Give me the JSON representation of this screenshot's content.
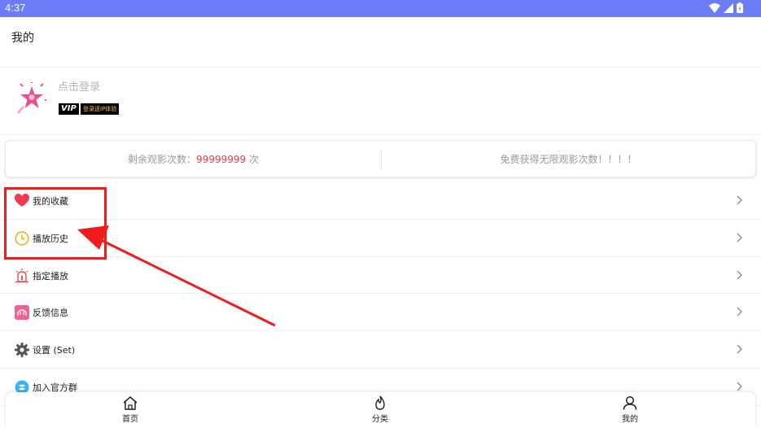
{
  "status_bar": {
    "time": "4:37"
  },
  "header": {
    "title": "我的"
  },
  "profile": {
    "login_text": "点击登录",
    "vip_badge": "VIP",
    "vip_text": "登录送IP体验"
  },
  "stats": {
    "remaining_prefix": "剩余观影次数：",
    "remaining_value": "99999999",
    "remaining_suffix": " 次",
    "free_text": "免费获得无限观影次数！！！！"
  },
  "menu": {
    "items": [
      {
        "label": "我的收藏",
        "icon": "heart-icon"
      },
      {
        "label": "播放历史",
        "icon": "clock-icon"
      },
      {
        "label": "指定播放",
        "icon": "alarm-icon"
      },
      {
        "label": "反馈信息",
        "icon": "feedback-icon"
      },
      {
        "label": "设置 (Set)",
        "icon": "gear-icon"
      },
      {
        "label": "加入官方群",
        "icon": "group-icon"
      }
    ]
  },
  "bottom_nav": {
    "home": "首页",
    "category": "分类",
    "mine": "我的"
  },
  "colors": {
    "status_bar": "#6b7cf5",
    "accent_red": "#ee3b3b",
    "annotation": "#f01b1b"
  }
}
